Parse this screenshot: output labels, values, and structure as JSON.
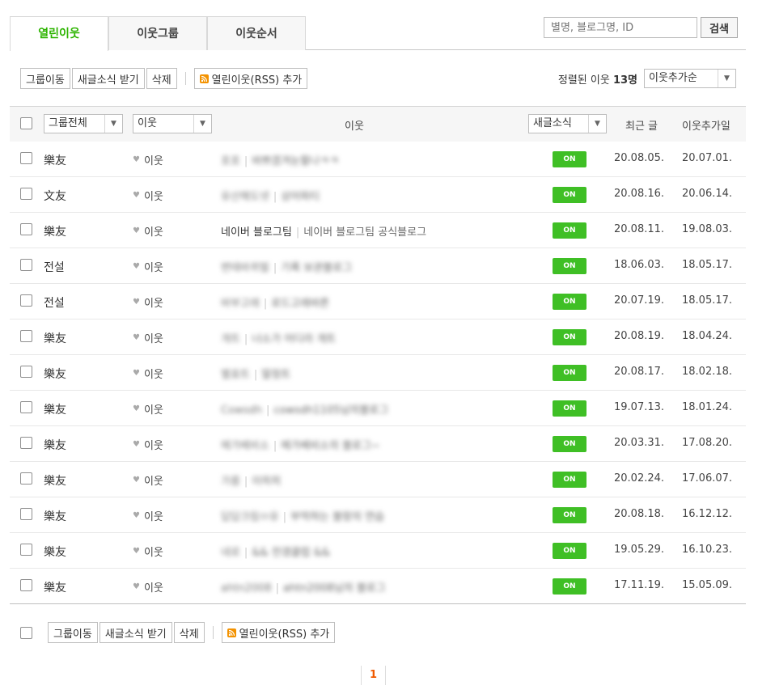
{
  "tabs": [
    {
      "label": "열린이웃"
    },
    {
      "label": "이웃그룹"
    },
    {
      "label": "이웃순서"
    }
  ],
  "search": {
    "placeholder": "별명, 블로그명, ID",
    "button": "검색"
  },
  "toolbar": {
    "group_move": "그룹이동",
    "receive_posts": "새글소식 받기",
    "delete": "삭제",
    "add_rss": "열린이웃(RSS) 추가"
  },
  "sort": {
    "prefix": "정렬된 이웃",
    "count": "13명",
    "selected": "이웃추가순"
  },
  "table_header": {
    "group_all": "그룹전체",
    "relation": "이웃",
    "neighbor": "이웃",
    "new_post_alert": "새글소식",
    "recent_post": "최근 글",
    "added_date": "이웃추가일"
  },
  "colors": {
    "accent": "#2db400",
    "on_badge": "#3fbf25",
    "page_active": "#f05a00"
  },
  "rows": [
    {
      "group": "樂友",
      "relation": "이웃",
      "name": "호호",
      "desc": "바쁘겠겨눈팔나ㅋㅋ",
      "alert": "ON",
      "recent": "20.08.05.",
      "added": "20.07.01."
    },
    {
      "group": "文友",
      "relation": "이웃",
      "name": "유산해도넷",
      "desc": "상어파티",
      "alert": "ON",
      "recent": "20.08.16.",
      "added": "20.06.14."
    },
    {
      "group": "樂友",
      "relation": "이웃",
      "name": "네이버 블로그팀",
      "desc": "네이버 블로그팀 공식블로그",
      "alert": "ON",
      "recent": "20.08.11.",
      "added": "19.08.03."
    },
    {
      "group": "전설",
      "relation": "이웃",
      "name": "변태바퀴벌",
      "desc": "기록 보관블로그",
      "alert": "ON",
      "recent": "18.06.03.",
      "added": "18.05.17."
    },
    {
      "group": "전설",
      "relation": "이웃",
      "name": "바부고래",
      "desc": "로드고래바른",
      "alert": "ON",
      "recent": "20.07.19.",
      "added": "18.05.17."
    },
    {
      "group": "樂友",
      "relation": "이웃",
      "name": "개트",
      "desc": "너소가 어디라 개트",
      "alert": "ON",
      "recent": "20.08.19.",
      "added": "18.04.24."
    },
    {
      "group": "樂友",
      "relation": "이웃",
      "name": "별효트",
      "desc": "딸정트",
      "alert": "ON",
      "recent": "20.08.17.",
      "added": "18.02.18."
    },
    {
      "group": "樂友",
      "relation": "이웃",
      "name": "Cowsdh",
      "desc": "cowsdh1105님의블로그",
      "alert": "ON",
      "recent": "19.07.13.",
      "added": "18.01.24."
    },
    {
      "group": "樂友",
      "relation": "이웃",
      "name": "메가베비소",
      "desc": "메가베비소의 블로그~",
      "alert": "ON",
      "recent": "20.03.31.",
      "added": "17.08.20."
    },
    {
      "group": "樂友",
      "relation": "이웃",
      "name": "가릉",
      "desc": "이히히",
      "alert": "ON",
      "recent": "20.02.24.",
      "added": "17.06.07."
    },
    {
      "group": "樂友",
      "relation": "이웃",
      "name": "답답크림ㅁ유",
      "desc": "부먹하는 블랑의 연습",
      "alert": "ON",
      "recent": "20.08.18.",
      "added": "16.12.12."
    },
    {
      "group": "樂友",
      "relation": "이웃",
      "name": "네로",
      "desc": "&& 전갱클럽 &&",
      "alert": "ON",
      "recent": "19.05.29.",
      "added": "16.10.23."
    },
    {
      "group": "樂友",
      "relation": "이웃",
      "name": "ahtn2008",
      "desc": "ahtn2008님의 블로그",
      "alert": "ON",
      "recent": "17.11.19.",
      "added": "15.05.09."
    }
  ],
  "pagination": {
    "current": "1"
  }
}
